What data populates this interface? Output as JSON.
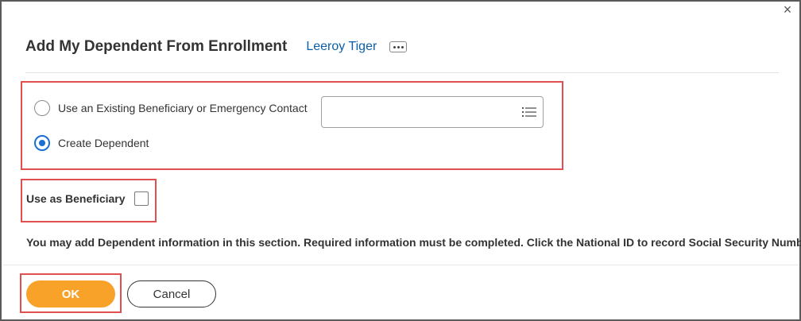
{
  "dialog": {
    "title": "Add My Dependent From Enrollment",
    "worker_name": "Leeroy Tiger",
    "close_glyph": "×"
  },
  "options": {
    "existing_label": "Use an Existing Beneficiary or Emergency Contact",
    "create_label": "Create Dependent",
    "selected": "create",
    "existing_prompt_value": ""
  },
  "beneficiary": {
    "label": "Use as Beneficiary",
    "checked": false
  },
  "info_text": "You may add Dependent information in this section. Required information must be completed. Click the National ID to record Social Security Numbers.",
  "buttons": {
    "ok_label": "OK",
    "cancel_label": "Cancel"
  },
  "colors": {
    "primary_button": "#f8a22a",
    "link": "#0b5ea8",
    "radio_selected": "#1a6fd4",
    "highlight_box": "#e05050"
  },
  "icons": {
    "close": "close-icon",
    "related_actions": "more-horizontal-icon",
    "prompt": "list-icon"
  }
}
